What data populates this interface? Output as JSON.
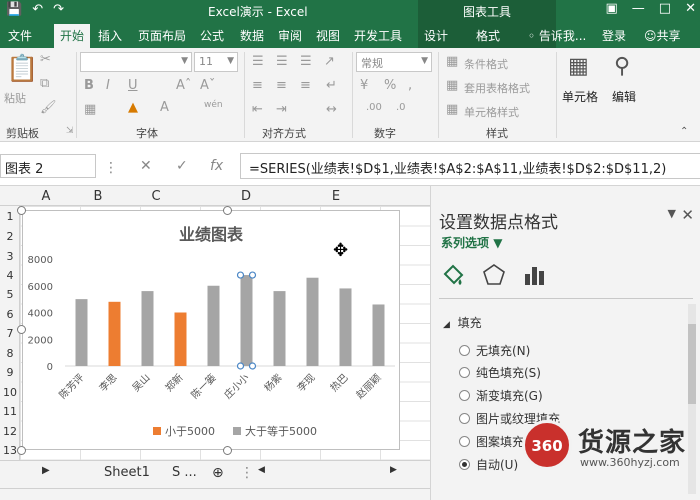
{
  "titlebar": {
    "title": "Excel演示 - Excel",
    "context_title": "图表工具",
    "icons": [
      "save-icon",
      "undo-icon",
      "redo-icon"
    ],
    "window_controls": [
      "ribbon-options-icon",
      "minimize-icon",
      "restore-icon",
      "close-icon"
    ]
  },
  "tabs": [
    {
      "label": "文件"
    },
    {
      "label": "开始"
    },
    {
      "label": "插入"
    },
    {
      "label": "页面布局"
    },
    {
      "label": "公式"
    },
    {
      "label": "数据"
    },
    {
      "label": "审阅"
    },
    {
      "label": "视图"
    },
    {
      "label": "开发工具"
    },
    {
      "label": "设计"
    },
    {
      "label": "格式"
    }
  ],
  "active_tab": "开始",
  "tell_me": "告诉我...",
  "signin": "登录",
  "share": "共享",
  "ribbon": {
    "paste": "粘贴",
    "font_size": "11",
    "number_format": "常规",
    "cond_format": "条件格式",
    "table_format": "套用表格格式",
    "cell_style": "单元格样式",
    "cells": "单元格",
    "editing": "编辑",
    "groups": {
      "clipboard": "剪贴板",
      "font": "字体",
      "alignment": "对齐方式",
      "number": "数字",
      "styles": "样式"
    }
  },
  "formula_bar": {
    "name_box": "图表 2",
    "fx": "fx",
    "formula": "=SERIES(业绩表!$D$1,业绩表!$A$2:$A$11,业绩表!$D$2:$D$11,2)"
  },
  "grid": {
    "columns": [
      "A",
      "B",
      "C",
      "D",
      "E"
    ],
    "rows": [
      "1",
      "2",
      "3",
      "4",
      "5",
      "6",
      "7",
      "8",
      "9",
      "10",
      "11",
      "12",
      "13"
    ]
  },
  "chart_data": {
    "type": "bar",
    "title": "业绩图表",
    "categories": [
      "陈芳评",
      "李思",
      "吴山",
      "郑新",
      "陈一篓",
      "庄小小",
      "杨紫",
      "李现",
      "热巴",
      "赵丽颖"
    ],
    "series": [
      {
        "name": "小于5000",
        "color": "#ed7d31",
        "values": [
          null,
          4800,
          null,
          4000,
          null,
          null,
          null,
          null,
          null,
          null
        ]
      },
      {
        "name": "大于等于5000",
        "color": "#a5a5a5",
        "values": [
          5000,
          null,
          5600,
          null,
          6000,
          6800,
          5600,
          6600,
          5800,
          4600
        ]
      }
    ],
    "ylim": [
      0,
      8000
    ],
    "yticks": [
      "0",
      "2000",
      "4000",
      "6000",
      "8000"
    ],
    "legend": "bottom",
    "grid": false
  },
  "sheets": {
    "tab1": "Sheet1",
    "tab2": "S ..."
  },
  "pane": {
    "title": "设置数据点格式",
    "subtitle": "系列选项",
    "section": "填充",
    "options": [
      {
        "label": "无填充(N)",
        "checked": false
      },
      {
        "label": "纯色填充(S)",
        "checked": false
      },
      {
        "label": "渐变填充(G)",
        "checked": false
      },
      {
        "label": "图片或纹理填充",
        "checked": false
      },
      {
        "label": "图案填充",
        "checked": false
      },
      {
        "label": "自动(U)",
        "checked": true
      }
    ]
  },
  "watermark": {
    "logo": "360",
    "text": "货源之家",
    "url": "www.360hyzj.com"
  }
}
